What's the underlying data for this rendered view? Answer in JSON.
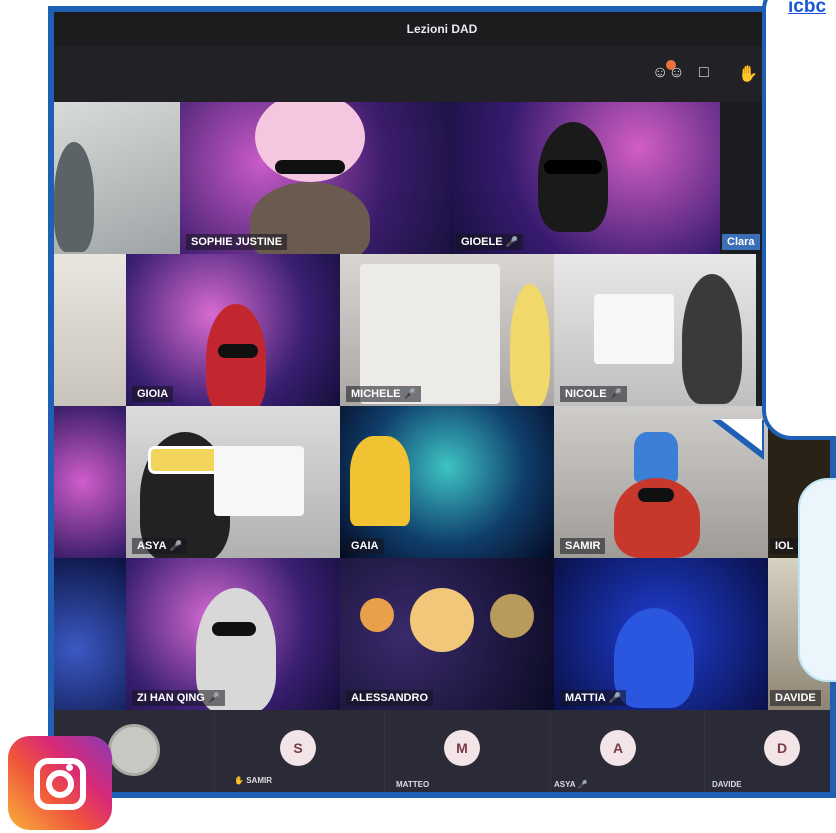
{
  "window": {
    "title": "Lezioni DAD"
  },
  "toolbar": {
    "icons": [
      "participants-icon",
      "chat-icon",
      "raise-hand-icon"
    ]
  },
  "participants": [
    {
      "name": "SOPHIE JUSTINE",
      "mic": false
    },
    {
      "name": "GIOELE",
      "mic": true
    },
    {
      "name": "Clara",
      "mic": false
    },
    {
      "name": "GIOIA",
      "mic": false
    },
    {
      "name": "MICHELE",
      "mic": true
    },
    {
      "name": "NICOLE",
      "mic": true
    },
    {
      "name": "ASYA",
      "mic": true
    },
    {
      "name": "GAIA",
      "mic": false
    },
    {
      "name": "SAMIR",
      "mic": false
    },
    {
      "name": "IOL",
      "mic": false
    },
    {
      "name": "ZI HAN QING",
      "mic": true
    },
    {
      "name": "ALESSANDRO",
      "mic": false
    },
    {
      "name": "MATTIA",
      "mic": true
    },
    {
      "name": "DAVIDE",
      "mic": false
    }
  ],
  "bottom_strip": [
    {
      "initial": "",
      "name": ""
    },
    {
      "initial": "S",
      "name": "SAMIR"
    },
    {
      "initial": "M",
      "name": "MATTEO"
    },
    {
      "initial": "A",
      "name": "ASYA"
    },
    {
      "initial": "D",
      "name": "DAVIDE"
    }
  ],
  "overlay": {
    "bubble_link": "icbc",
    "brand_colors": {
      "frame": "#1f5fb4",
      "link": "#1a56d8"
    }
  }
}
